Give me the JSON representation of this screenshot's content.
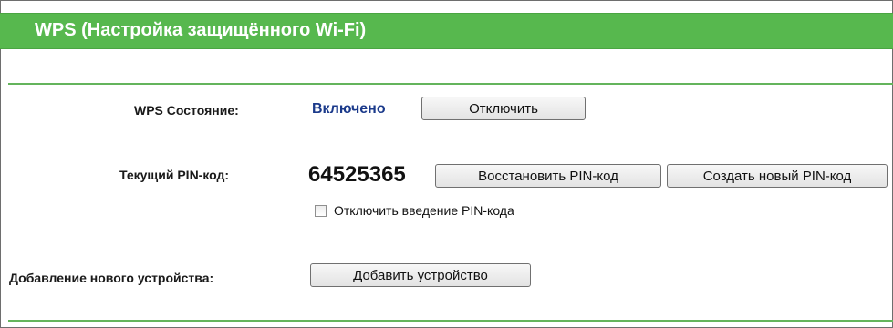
{
  "title": "WPS (Настройка защищённого Wi-Fi)",
  "wps_status": {
    "label": "WPS Состояние:",
    "value": "Включено",
    "button_label": "Отключить"
  },
  "pin": {
    "label": "Текущий PIN-код:",
    "value": "64525365",
    "restore_button_label": "Восстановить PIN-код",
    "new_button_label": "Создать новый PIN-код",
    "disable_checkbox_label": "Отключить введение PIN-кода",
    "disable_checkbox_checked": false
  },
  "add_device": {
    "label": "Добавление нового устройства:",
    "button_label": "Добавить устройство"
  },
  "colors": {
    "header_green": "#57b84e",
    "status_blue": "#1b3a8b"
  }
}
